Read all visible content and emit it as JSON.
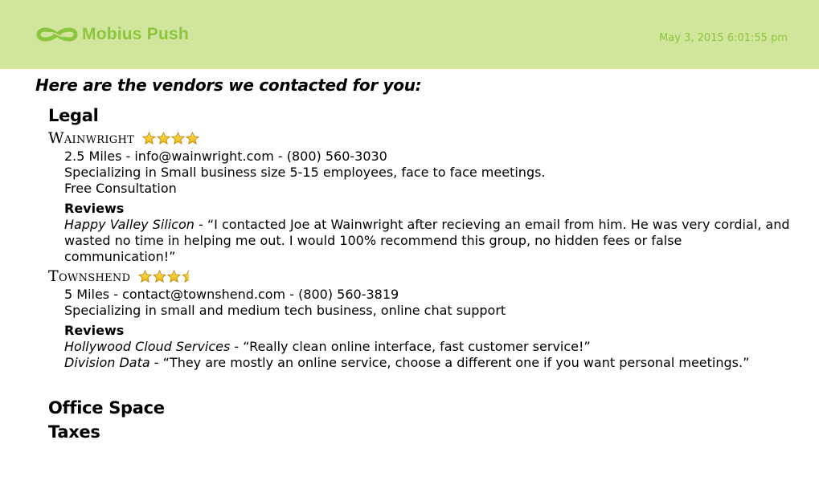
{
  "header": {
    "brand": "Mobius Push",
    "timestamp": "May 3, 2015 6:01:55 pm",
    "logo_icon": "infinity-icon",
    "colors": {
      "background": "#d1e69c",
      "accent": "#8cc63f"
    }
  },
  "intro": "Here are the vendors we contacted for you:",
  "categories": [
    {
      "title": "Legal",
      "vendors": [
        {
          "name": "Wainwright",
          "rating": 4,
          "rating_max": 4,
          "contact": "2.5 Miles - info@wainwright.com - (800) 560-3030",
          "specialty": "Specializing in Small business size 5-15 employees, face to face meetings.",
          "extra": "Free Consultation",
          "reviews_heading": "Reviews",
          "reviews": [
            {
              "source": "Happy Valley Silicon",
              "text": " - “I contacted Joe at Wainwright after recieving an email from him. He was very cordial, and wasted no time in helping me out. I would 100% recommend this group, no hidden fees or false communication!”"
            }
          ]
        },
        {
          "name": "Townshend",
          "rating": 3.5,
          "rating_max": 4,
          "contact": "5 Miles - contact@townshend.com - (800) 560-3819",
          "specialty": "Specializing in small and medium tech business, online chat support",
          "reviews_heading": "Reviews",
          "reviews": [
            {
              "source": "Hollywood Cloud Services",
              "text": " - “Really clean online interface, fast customer service!”"
            },
            {
              "source": "Division Data",
              "text": " - “They are mostly an online service, choose a different one if you want personal meetings.”"
            }
          ]
        }
      ]
    },
    {
      "title": "Office Space"
    },
    {
      "title": "Taxes"
    }
  ]
}
